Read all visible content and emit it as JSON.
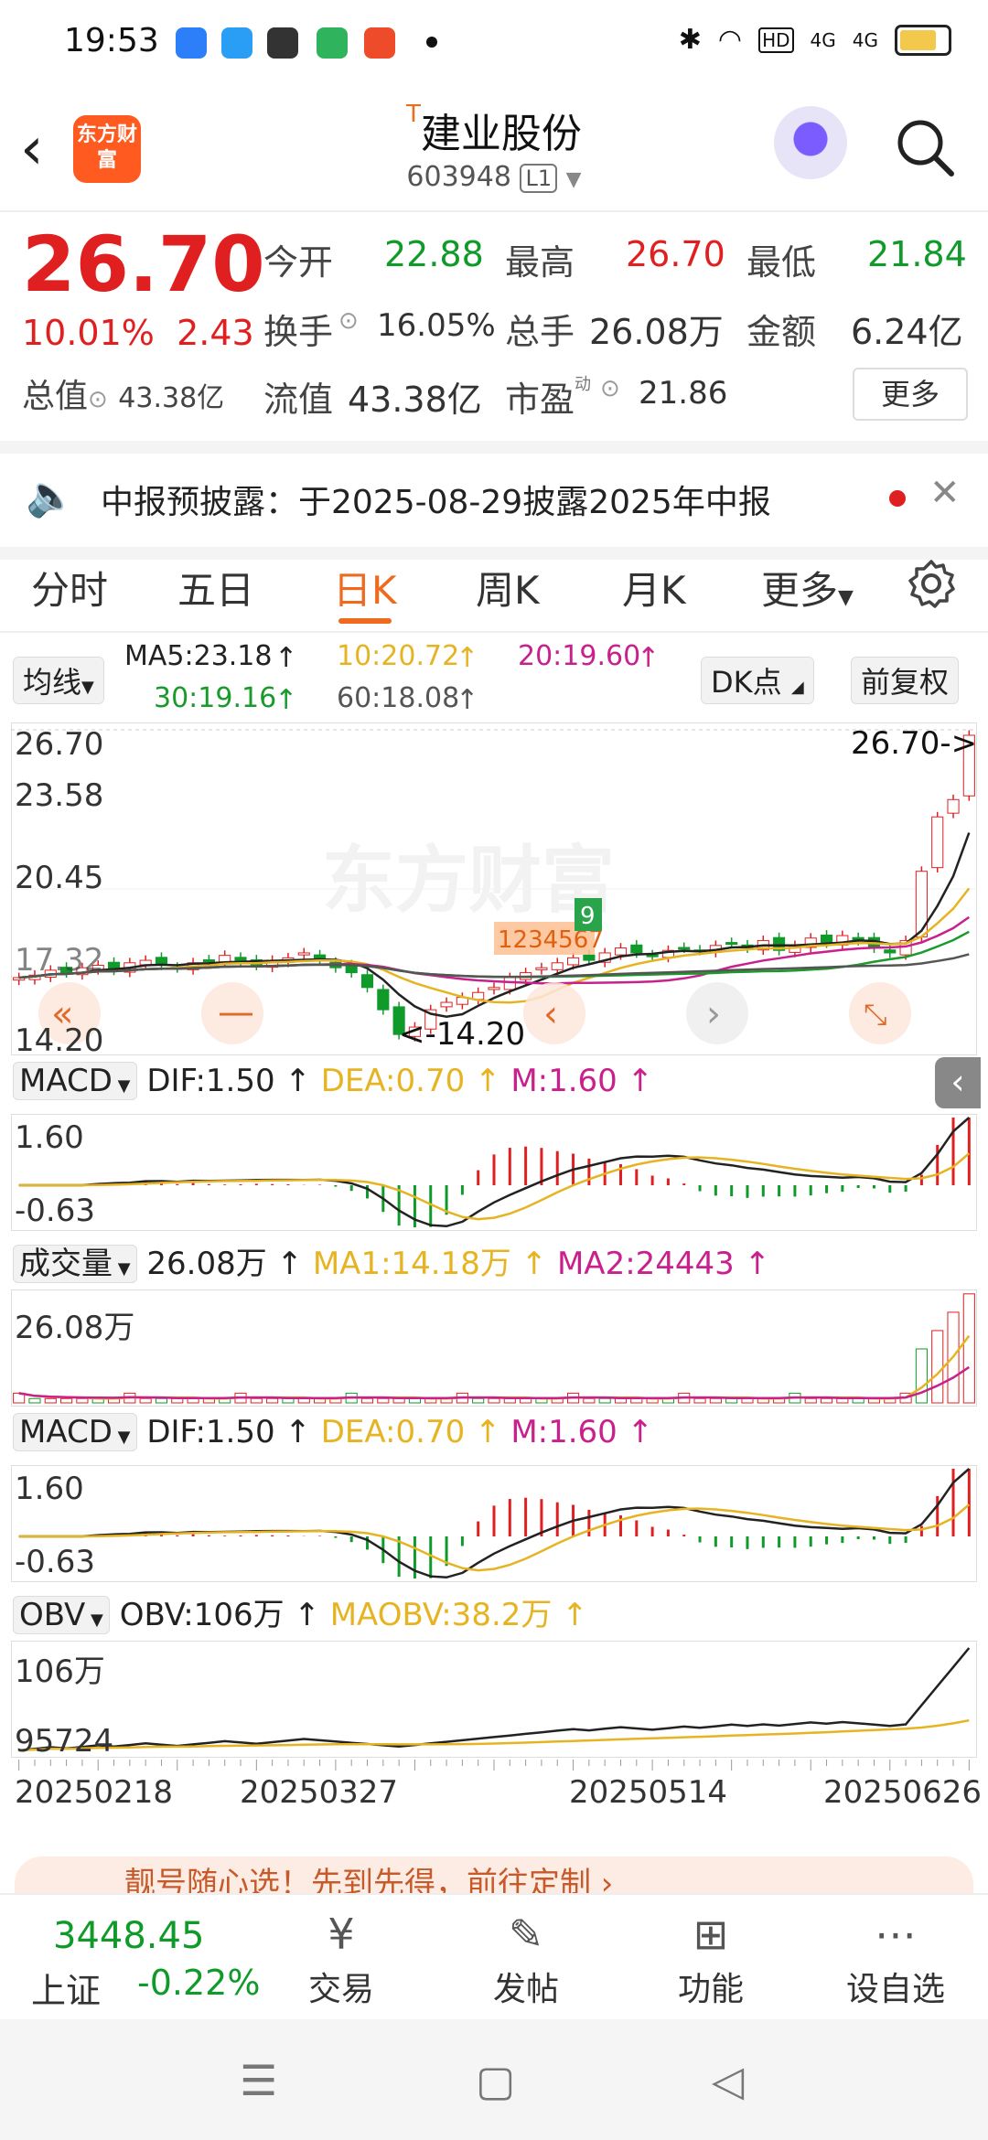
{
  "status": {
    "time": "19:53",
    "net1": "HD",
    "net2": "4G",
    "net3": "4G"
  },
  "header": {
    "back": "‹",
    "logo": "东方财富",
    "name_sup": "T",
    "name": "建业股份",
    "code": "603948",
    "badge": "L1"
  },
  "quote": {
    "price": "26.70",
    "pct": "10.01%",
    "change": "2.43",
    "total_value_label": "总值",
    "total_value": "43.38亿",
    "open_label": "今开",
    "open": "22.88",
    "high_label": "最高",
    "high": "26.70",
    "low_label": "最低",
    "low": "21.84",
    "turnover_label": "换手",
    "turnover": "16.05%",
    "volume_label": "总手",
    "volume": "26.08万",
    "amount_label": "金额",
    "amount": "6.24亿",
    "float_label": "流值",
    "float_value": "43.38亿",
    "pe_label": "市盈",
    "pe_sup": "动",
    "pe": "21.86",
    "more": "更多"
  },
  "notice": {
    "text": "中报预披露：于2025-08-29披露2025年中报"
  },
  "tabs": [
    "分时",
    "五日",
    "日K",
    "周K",
    "月K",
    "更多"
  ],
  "ma": {
    "selector": "均线",
    "ma5": "MA5:23.18",
    "ma10": "10:20.72",
    "ma20": "20:19.60",
    "ma30": "30:19.16",
    "ma60": "60:18.08",
    "dk": "DK点",
    "adjust": "前复权",
    "colors": {
      "ma5": "#222222",
      "ma10": "#e6b422",
      "ma20": "#c8208c",
      "ma30": "#1a9a2a",
      "ma60": "#555555"
    }
  },
  "main_chart": {
    "y_labels": [
      "26.70",
      "23.58",
      "20.45",
      "17.32",
      "14.20"
    ],
    "max_label": "26.70->",
    "min_label": "<-14.20",
    "watermark": "东方财富",
    "marker": "9",
    "marker_text": "1234567"
  },
  "macd1": {
    "selector": "MACD",
    "dif": "DIF:1.50",
    "dea": "DEA:0.70",
    "m": "M:1.60",
    "y_top": "1.60",
    "y_bottom": "-0.63"
  },
  "volume": {
    "selector": "成交量",
    "value": "26.08万",
    "ma1": "MA1:14.18万",
    "ma2": "MA2:24443",
    "y_top": "26.08万"
  },
  "macd2": {
    "selector": "MACD",
    "dif": "DIF:1.50",
    "dea": "DEA:0.70",
    "m": "M:1.60",
    "y_top": "1.60",
    "y_bottom": "-0.63"
  },
  "obv": {
    "selector": "OBV",
    "obv": "OBV:106万",
    "maobv": "MAOBV:38.2万",
    "y_top": "106万",
    "y_bottom": "95724"
  },
  "dates": [
    "20250218",
    "20250327",
    "20250514",
    "20250626"
  ],
  "banner": {
    "text": "靓号随心选！先到先得，前往定制 ›"
  },
  "bottom": {
    "index_value": "3448.45",
    "index_name": "上证",
    "index_change": "-0.22%",
    "trade": "交易",
    "post": "发帖",
    "function": "功能",
    "watchlist": "设自选"
  },
  "chart_data": {
    "type": "candlestick",
    "y_range": [
      14.2,
      26.7
    ],
    "last_close": 26.7,
    "low": 14.2,
    "closes": [
      16.9,
      17.0,
      17.2,
      17.1,
      17.3,
      17.4,
      17.2,
      17.5,
      17.6,
      17.4,
      17.3,
      17.5,
      17.6,
      17.8,
      17.5,
      17.4,
      17.6,
      17.7,
      17.9,
      17.6,
      17.3,
      17.1,
      16.5,
      15.6,
      14.6,
      14.9,
      15.6,
      15.9,
      16.1,
      16.3,
      16.5,
      16.9,
      17.1,
      17.3,
      17.5,
      17.7,
      17.6,
      17.9,
      18.1,
      17.9,
      17.8,
      18.0,
      18.1,
      18.0,
      18.2,
      18.3,
      18.1,
      18.4,
      18.0,
      18.2,
      18.5,
      18.3,
      18.6,
      18.4,
      18.1,
      17.9,
      18.4,
      21.2,
      23.4,
      24.1,
      26.7
    ]
  }
}
